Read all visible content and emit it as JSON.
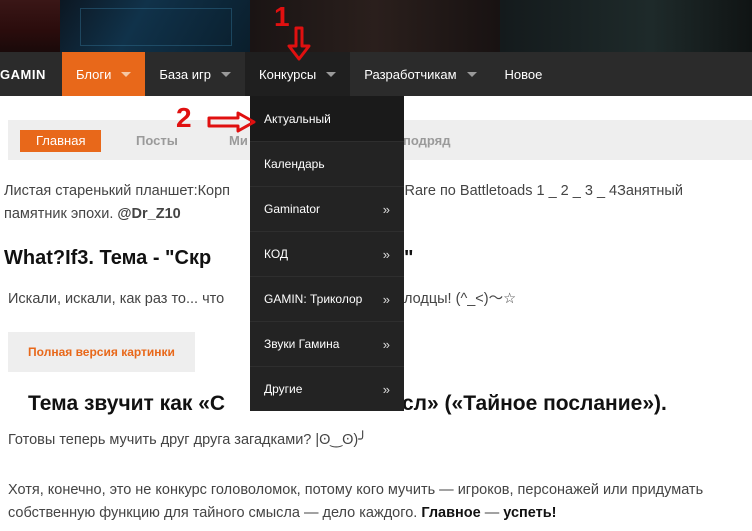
{
  "nav": {
    "logo": "GAMIN",
    "items": [
      {
        "label": "Блоги",
        "caret": true
      },
      {
        "label": "База игр",
        "caret": true
      },
      {
        "label": "Конкурсы",
        "caret": true
      },
      {
        "label": "Разработчикам",
        "caret": true
      },
      {
        "label": "Новое",
        "caret": false
      }
    ],
    "active_color": "#e8681a"
  },
  "dropdown": {
    "items": [
      {
        "label": "Актуальный",
        "arrow": ""
      },
      {
        "label": "Календарь",
        "arrow": ""
      },
      {
        "label": "Gaminator",
        "arrow": "»"
      },
      {
        "label": "КОД",
        "arrow": "»"
      },
      {
        "label": "GAMIN: Триколор",
        "arrow": "»"
      },
      {
        "label": "Звуки Гамина",
        "arrow": "»"
      },
      {
        "label": "Другие",
        "arrow": "»"
      }
    ]
  },
  "tabs": {
    "home": "Главная",
    "posts": "Посты",
    "mi": "Ми",
    "podryad": "подряд"
  },
  "content": {
    "p1_line1_a": "Листая старенький планшет:Корп",
    "p1_line1_b": "ы Rare по Battletoads 1 _ 2 _ 3 _ 4Занятный",
    "p1_line2": "памятник эпохи.",
    "p1_author": "@Dr_Z10",
    "h1_a": "What?If3. Тема - \"Скр",
    "h1_b": "\"",
    "p2_a": "Искали, искали, как раз то... что",
    "p2_b": "лодцы! (^_<)〜☆",
    "full_image": "Полная версия картинки",
    "h2_a": "Тема звучит как «С",
    "h2_b": "сл» («Тайное послание»).",
    "p3": "Готовы теперь мучить друг друга загадками? |ʘ‿ʘ)╯",
    "p4_text": "Хотя, конечно, это не конкурс головоломок, потому кого мучить — игроков, персонажей или придумать собственную функцию для тайного смысла — дело каждого.",
    "p4_bold1": "Главное",
    "p4_dash": "—",
    "p4_bold2": "успеть!"
  },
  "annotations": {
    "one": "1",
    "two": "2",
    "color": "#e01010"
  }
}
